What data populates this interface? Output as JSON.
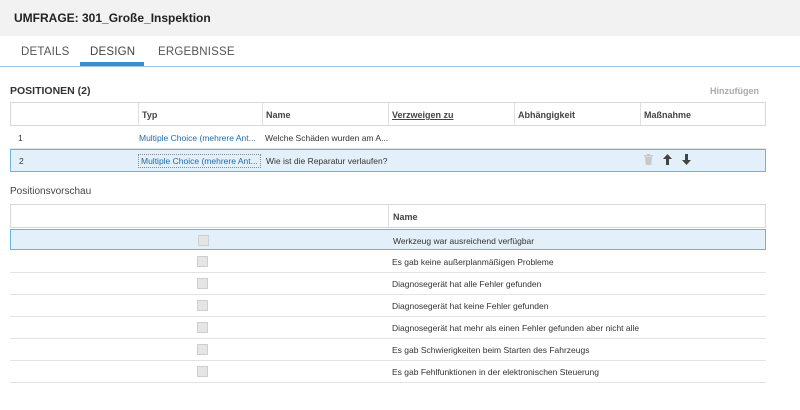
{
  "header": {
    "title": "UMFRAGE: 301_Große_Inspektion"
  },
  "tabs": [
    {
      "label": "DETAILS"
    },
    {
      "label": "DESIGN"
    },
    {
      "label": "ERGEBNISSE"
    }
  ],
  "positions": {
    "title": "POSITIONEN (2)",
    "add_label": "Hinzufügen",
    "columns": [
      "Typ",
      "Name",
      "Verzweigen zu",
      "Abhängigkeit",
      "Maßnahme"
    ],
    "rows": [
      {
        "num": "1",
        "type": "Multiple Choice (mehrere Ant...",
        "name": "Welche Schäden wurden am A..."
      },
      {
        "num": "2",
        "type": "Multiple Choice (mehrere Ant...",
        "name": "Wie ist die Reparatur verlaufen?"
      }
    ]
  },
  "preview": {
    "title": "Positionsvorschau",
    "column": "Name",
    "rows": [
      "Werkzeug war ausreichend verfügbar",
      "Es gab keine außerplanmäßigen Probleme",
      "Diagnosegerät hat alle Fehler gefunden",
      "Diagnosegerät hat keine Fehler gefunden",
      "Diagnosegerät hat mehr als einen Fehler gefunden aber nicht alle",
      "Es gab Schwierigkeiten beim Starten des Fahrzeugs",
      "Es gab Fehlfunktionen in der elektronischen Steuerung"
    ]
  },
  "icons": {
    "delete": "trash-icon",
    "up": "arrow-up-icon",
    "down": "arrow-down-icon"
  },
  "colors": {
    "accent": "#3a8ed0",
    "link": "#1f6aa8",
    "selection_bg": "#e4f0f9",
    "selection_border": "#6fb1df"
  }
}
